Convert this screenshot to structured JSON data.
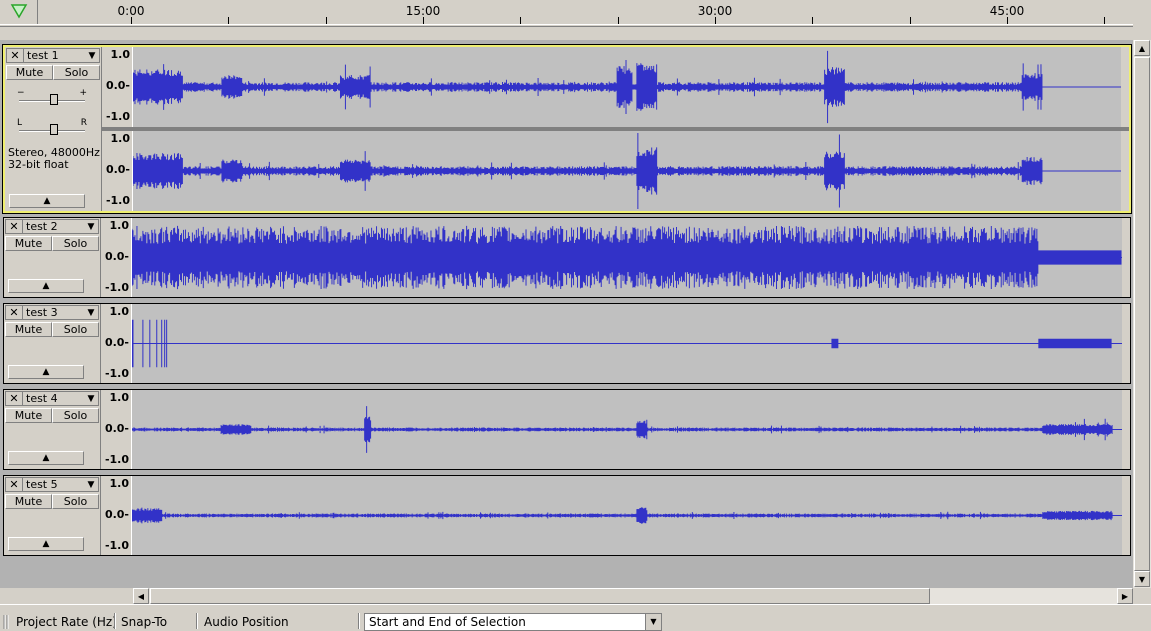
{
  "ruler": {
    "play_icon_color": "#2aa52a",
    "ticks": [
      "0:00",
      "15:00",
      "30:00",
      "45:00"
    ]
  },
  "tracks": [
    {
      "name": "test 1",
      "mute": "Mute",
      "solo": "Solo",
      "info_line1": "Stereo, 48000Hz",
      "info_line2": "32-bit float",
      "gain_minus": "−",
      "gain_plus": "+",
      "pan_left": "L",
      "pan_right": "R",
      "selected": true,
      "scale": [
        "1.0",
        "0.0-",
        "-1.0"
      ]
    },
    {
      "name": "test 2",
      "mute": "Mute",
      "solo": "Solo",
      "scale": [
        "1.0",
        "0.0-",
        "-1.0"
      ]
    },
    {
      "name": "test 3",
      "mute": "Mute",
      "solo": "Solo",
      "scale": [
        "1.0",
        "0.0-",
        "-1.0"
      ]
    },
    {
      "name": "test 4",
      "mute": "Mute",
      "solo": "Solo",
      "scale": [
        "1.0",
        "0.0-",
        "-1.0"
      ]
    },
    {
      "name": "test 5",
      "mute": "Mute",
      "solo": "Solo",
      "scale": [
        "1.0",
        "0.0-",
        "-1.0"
      ]
    }
  ],
  "colors": {
    "waveform": "#3232c8",
    "selected_border": "#efef70",
    "wave_bg": "#c0c0c0"
  },
  "statusbar": {
    "project_rate": "Project Rate (Hz)",
    "snap_to": "Snap-To",
    "audio_position": "Audio Position",
    "selection_mode": "Start and End of Selection"
  }
}
